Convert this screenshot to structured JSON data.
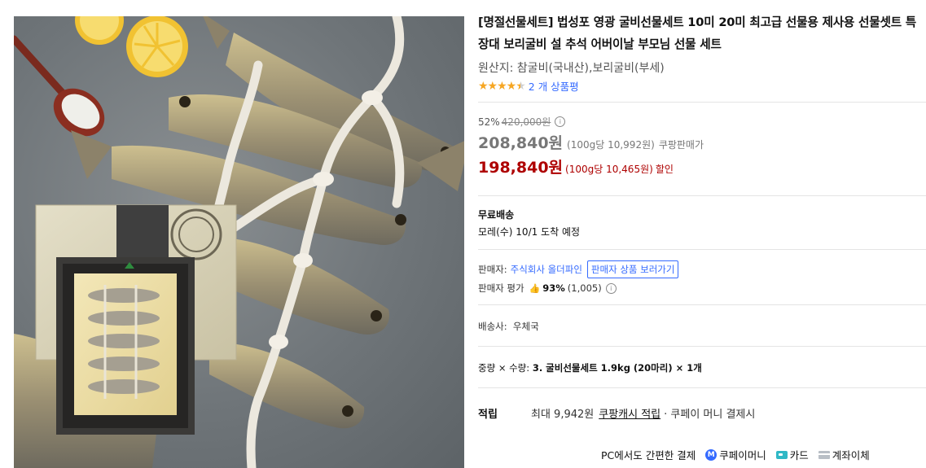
{
  "product": {
    "title": "[명절선물세트] 법성포 영광 굴비선물세트 10미 20미 최고급 선물용 제사용 선물셋트 특장대 보리굴비 설 추석 어버이날 부모님 선물 세트",
    "origin": "원산지: 참굴비(국내산),보리굴비(부세)",
    "rating": 4.5,
    "stars_display": "★★★★",
    "review_count_label": "2 개 상품평"
  },
  "pricing": {
    "discount_rate": "52%",
    "original_price": "420,000원",
    "info_icon": "i",
    "price": "208,840원",
    "unit_price": "(100g당 10,992원)",
    "price_seller": "쿠팡판매가",
    "coupon_price": "198,840원",
    "coupon_unit_price": "(100g당 10,465원)",
    "coupon_label": "할인"
  },
  "shipping": {
    "label": "무료배송",
    "delivery": "모레(수) 10/1 도착 예정"
  },
  "seller": {
    "label": "판매자:",
    "name": "주식회사 올더파인",
    "button": "판매자 상품 보러가기",
    "rating_label": "판매자 평가",
    "rating_pct": "93%",
    "rating_count": "(1,005)"
  },
  "carrier": {
    "text": "배송사:  우체국"
  },
  "option": {
    "label": "중량 × 수량:",
    "value": "3. 굴비선물세트 1.9kg (20마리) × 1개"
  },
  "reward": {
    "label": "적립",
    "prefix": "최대 9,942원",
    "link": "쿠팡캐시 적립",
    "suffix": "· 쿠페이 머니 결제시"
  },
  "payment": {
    "heading": "PC에서도 간편한 결제",
    "coupay_badge": "M",
    "coupay": "쿠페이머니",
    "card": "카드",
    "bank": "계좌이체"
  },
  "colors": {
    "accent_blue": "#346aff",
    "sale_red": "#ae0000",
    "star": "#f6a623"
  }
}
